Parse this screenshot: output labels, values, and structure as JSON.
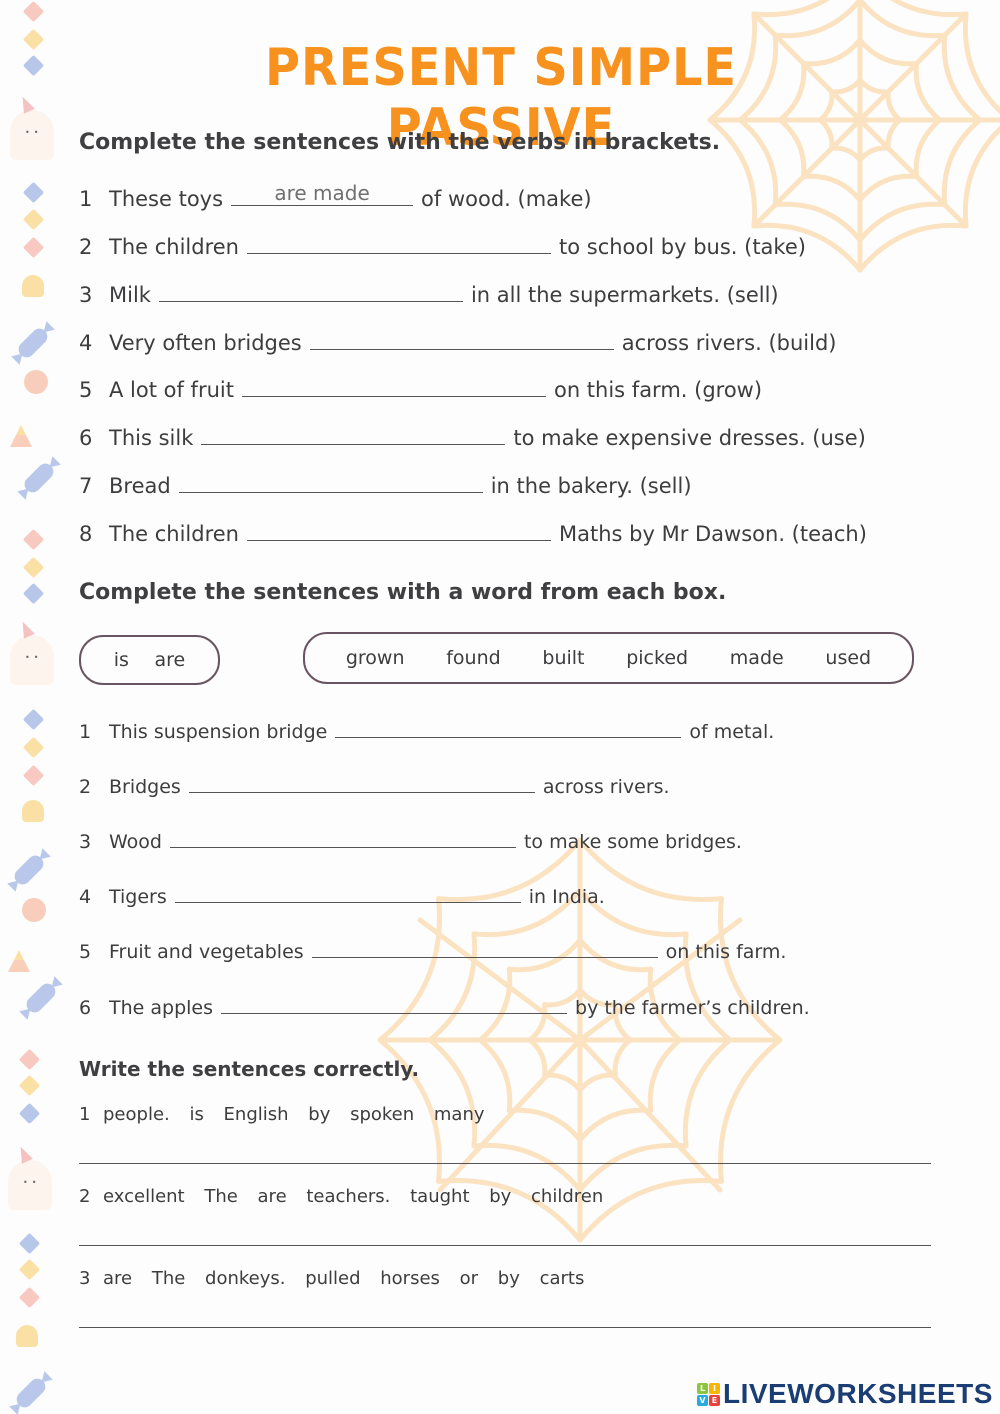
{
  "title": "PRESENT SIMPLE PASSIVE",
  "colors": {
    "title": "#f7921e",
    "text": "#3d3d3f",
    "web": "#fbe3c2",
    "box_border": "#6b5462",
    "logo": "#1a3d73"
  },
  "section1": {
    "heading": "Complete the sentences with the verbs in brackets.",
    "items": [
      {
        "num": "1",
        "before": "These toys",
        "answer": "are made",
        "after": "of wood. (make)"
      },
      {
        "num": "2",
        "before": "The children",
        "answer": "",
        "after": "to school by bus. (take)"
      },
      {
        "num": "3",
        "before": "Milk",
        "answer": "",
        "after": "in all the supermarkets. (sell)"
      },
      {
        "num": "4",
        "before": "Very often bridges",
        "answer": "",
        "after": "across rivers. (build)"
      },
      {
        "num": "5",
        "before": "A lot of fruit",
        "answer": "",
        "after": "on this farm. (grow)"
      },
      {
        "num": "6",
        "before": "This silk",
        "answer": "",
        "after": "to make expensive dresses. (use)"
      },
      {
        "num": "7",
        "before": "Bread",
        "answer": "",
        "after": "in the bakery. (sell)"
      },
      {
        "num": "8",
        "before": "The children",
        "answer": "",
        "after": "Maths by Mr Dawson. (teach)"
      }
    ]
  },
  "section2": {
    "heading": "Complete the sentences with a word from each box.",
    "box1": [
      "is",
      "are"
    ],
    "box2": [
      "grown",
      "found",
      "built",
      "picked",
      "made",
      "used"
    ],
    "items": [
      {
        "num": "1",
        "before": "This suspension bridge",
        "after": "of metal."
      },
      {
        "num": "2",
        "before": "Bridges",
        "after": "across rivers."
      },
      {
        "num": "3",
        "before": "Wood",
        "after": "to make some bridges."
      },
      {
        "num": "4",
        "before": "Tigers",
        "after": "in India."
      },
      {
        "num": "5",
        "before": "Fruit and vegetables",
        "after": "on this farm."
      },
      {
        "num": "6",
        "before": "The apples",
        "after": "by the farmer’s children."
      }
    ]
  },
  "section3": {
    "heading": "Write the sentences correctly.",
    "items": [
      {
        "num": "1",
        "words": "people. is English by spoken many"
      },
      {
        "num": "2",
        "words": "excellent The are teachers. taught by children"
      },
      {
        "num": "3",
        "words": "are The donkeys. pulled horses or by carts"
      }
    ]
  },
  "logo": {
    "text": "LIVEWORKSHEETS",
    "squares": [
      "L",
      "I",
      "V",
      "E"
    ]
  }
}
